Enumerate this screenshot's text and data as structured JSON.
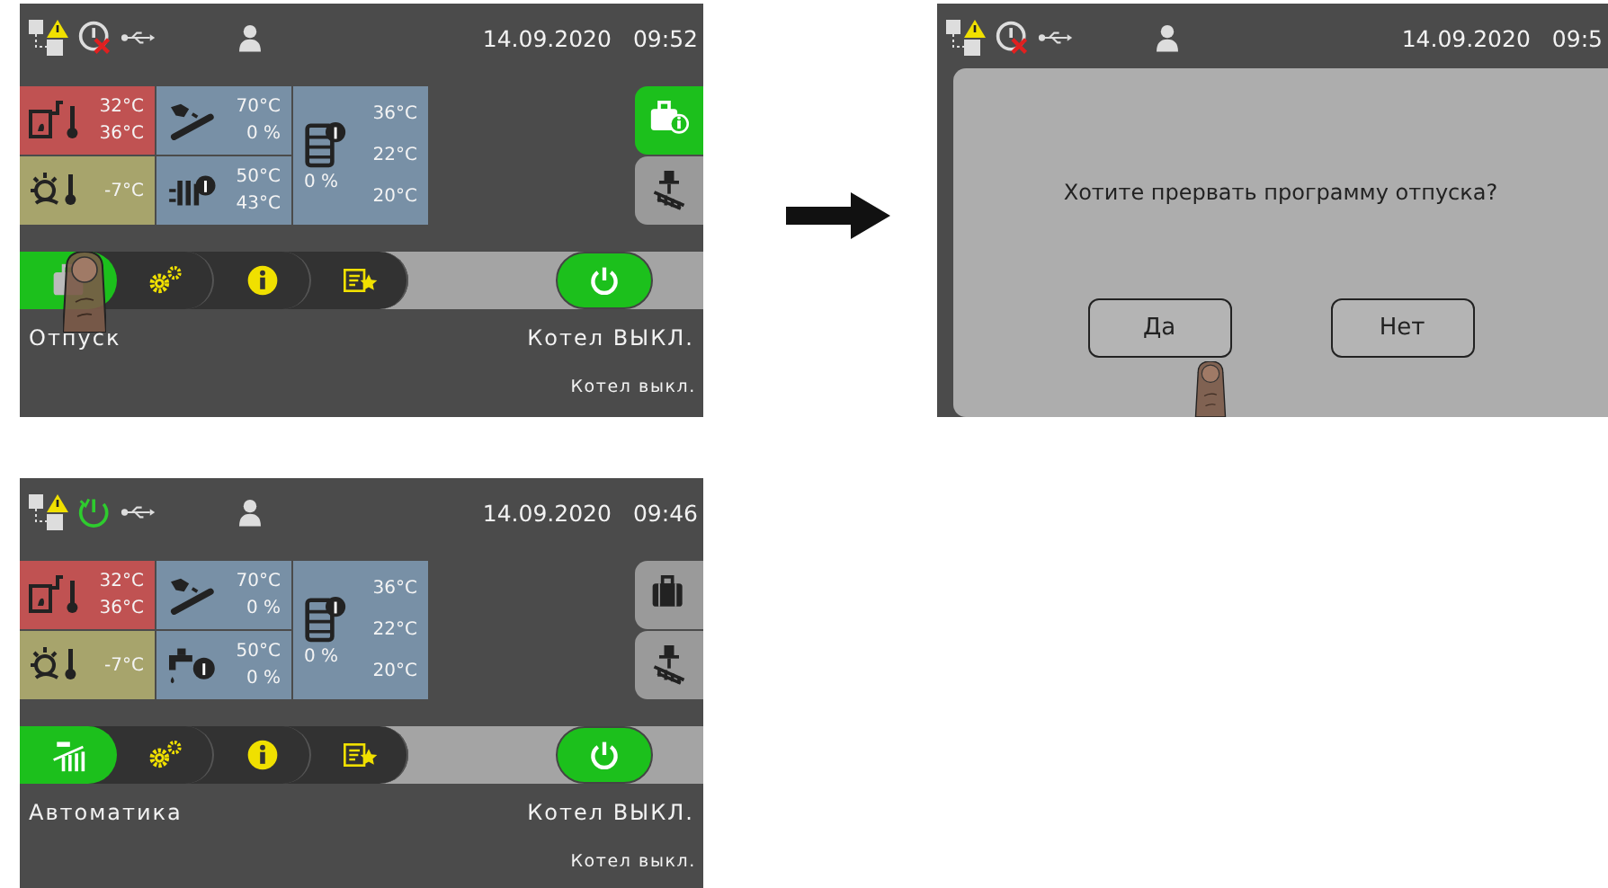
{
  "screens": [
    {
      "status_bar": {
        "power_ok": false,
        "date": "14.09.2020",
        "time": "09:52"
      },
      "tile_columns": [
        [
          {
            "kind": "boiler",
            "color": "#c05252",
            "values": [
              "32°C",
              "36°C"
            ]
          },
          {
            "kind": "outdoor",
            "color": "#a7a46c",
            "values": [
              "-7°C"
            ]
          }
        ],
        [
          {
            "kind": "solar",
            "color": "#7890a6",
            "values": [
              "70°C",
              "0 %"
            ]
          },
          {
            "kind": "circuit",
            "color": "#7890a6",
            "values": [
              "50°C",
              "43°C"
            ]
          }
        ],
        [
          {
            "kind": "tank",
            "color": "#7890a6",
            "values": [
              "36°C",
              "22°C",
              "20°C"
            ],
            "level_text": "0 %"
          }
        ]
      ],
      "side_buttons": [
        {
          "kind": "vacation-info",
          "active": true
        },
        {
          "kind": "chimney",
          "active": false
        }
      ],
      "mode_button": {
        "kind": "vacation",
        "active": true,
        "pressed": true
      },
      "power_button": {
        "on": true
      },
      "mode_label": "Отпуск",
      "boiler_label": "Котел ВЫКЛ.",
      "status_text": "Котел выкл."
    },
    {
      "status_bar": {
        "power_ok": false,
        "date": "14.09.2020",
        "time": "09:5"
      },
      "dialog": {
        "message": "Хотите прервать программу отпуска?",
        "buttons": [
          {
            "label": "Да",
            "pressed": true
          },
          {
            "label": "Нет",
            "pressed": false
          }
        ]
      }
    },
    {
      "status_bar": {
        "power_ok": true,
        "date": "14.09.2020",
        "time": "09:46"
      },
      "tile_columns": [
        [
          {
            "kind": "boiler",
            "color": "#c05252",
            "values": [
              "32°C",
              "36°C"
            ]
          },
          {
            "kind": "outdoor",
            "color": "#a7a46c",
            "values": [
              "-7°C"
            ]
          }
        ],
        [
          {
            "kind": "solar",
            "color": "#7890a6",
            "values": [
              "70°C",
              "0 %"
            ]
          },
          {
            "kind": "hot-water",
            "color": "#7890a6",
            "values": [
              "50°C",
              "0 %"
            ]
          }
        ],
        [
          {
            "kind": "tank",
            "color": "#7890a6",
            "values": [
              "36°C",
              "22°C",
              "20°C"
            ],
            "level_text": "0 %"
          }
        ]
      ],
      "side_buttons": [
        {
          "kind": "vacation",
          "active": false
        },
        {
          "kind": "chimney",
          "active": false
        }
      ],
      "mode_button": {
        "kind": "auto",
        "active": true
      },
      "power_button": {
        "on": true
      },
      "mode_label": "Автоматика",
      "boiler_label": "Котел ВЫКЛ.",
      "status_text": "Котел выкл."
    }
  ]
}
